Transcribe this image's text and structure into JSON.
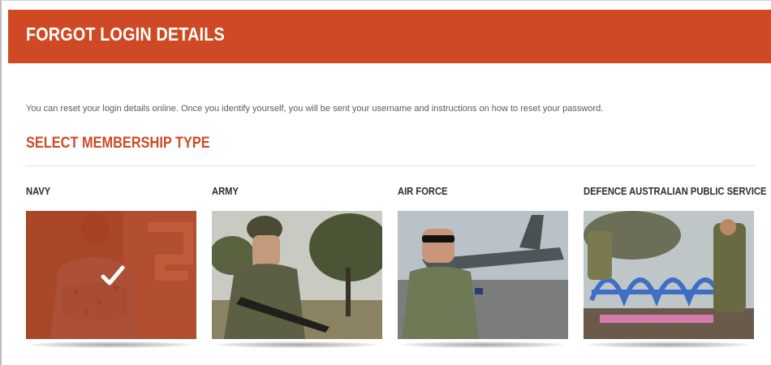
{
  "header": {
    "title": "FORGOT LOGIN DETAILS"
  },
  "intro": "You can reset your login details online. Once you identify yourself, you will be sent your username and instructions on how to reset your password.",
  "section_title": "SELECT MEMBERSHIP TYPE",
  "membership_options": [
    {
      "label": "NAVY",
      "selected": true,
      "icon": "checkmark-icon"
    },
    {
      "label": "ARMY",
      "selected": false
    },
    {
      "label": "AIR FORCE",
      "selected": false
    },
    {
      "label": "DEFENCE AUSTRALIAN PUBLIC SERVICE",
      "selected": false
    }
  ],
  "colors": {
    "accent": "#cf4a24",
    "text": "#5a5a5a"
  }
}
